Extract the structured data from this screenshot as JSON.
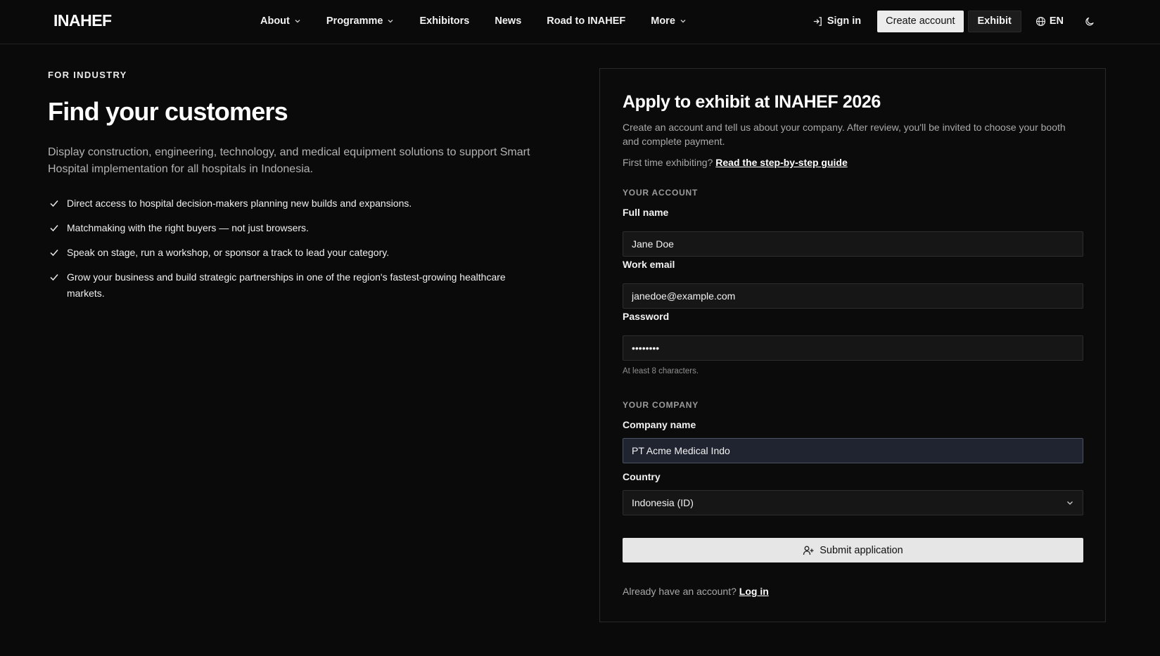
{
  "header": {
    "logo": "INAHEF",
    "nav": [
      {
        "label": "About",
        "dropdown": true
      },
      {
        "label": "Programme",
        "dropdown": true
      },
      {
        "label": "Exhibitors",
        "dropdown": false
      },
      {
        "label": "News",
        "dropdown": false
      },
      {
        "label": "Road to INAHEF",
        "dropdown": false
      },
      {
        "label": "More",
        "dropdown": true
      }
    ],
    "signin": "Sign in",
    "create_account": "Create account",
    "exhibit": "Exhibit",
    "language": "EN",
    "icons": {
      "signin": "sign-in-icon",
      "language": "globe-icon",
      "theme": "moon-icon",
      "dropdown": "chevron-down-icon"
    }
  },
  "hero": {
    "eyebrow": "FOR INDUSTRY",
    "title": "Find your customers",
    "lead": "Display construction, engineering, technology, and medical equipment solutions to support Smart Hospital implementation for all hospitals in Indonesia.",
    "benefits": [
      "Direct access to hospital decision-makers planning new builds and expansions.",
      "Matchmaking with the right buyers — not just browsers.",
      "Speak on stage, run a workshop, or sponsor a track to lead your category.",
      "Grow your business and build strategic partnerships in one of the region's fastest-growing healthcare markets."
    ]
  },
  "form": {
    "title": "Apply to exhibit at INAHEF 2026",
    "description": "Create an account and tell us about your company. After review, you'll be invited to choose your booth and complete payment.",
    "guide_prefix": "First time exhibiting?",
    "guide_link": "Read the step-by-step guide",
    "account_section": "YOUR ACCOUNT",
    "full_name": {
      "label": "Full name",
      "value": "Jane Doe"
    },
    "email": {
      "label": "Work email",
      "value": "janedoe@example.com"
    },
    "password": {
      "label": "Password",
      "value": "password",
      "hint": "At least 8 characters."
    },
    "company_section": "YOUR COMPANY",
    "company": {
      "label": "Company name",
      "value": "PT Acme Medical Indo"
    },
    "country": {
      "label": "Country",
      "value": "Indonesia (ID)"
    },
    "submit": "Submit application",
    "login_prefix": "Already have an account?",
    "login_link": "Log in"
  },
  "colors": {
    "background": "#0a0a0a",
    "primary_button": "#e6e6e6",
    "focused_input": "#1f2430"
  }
}
